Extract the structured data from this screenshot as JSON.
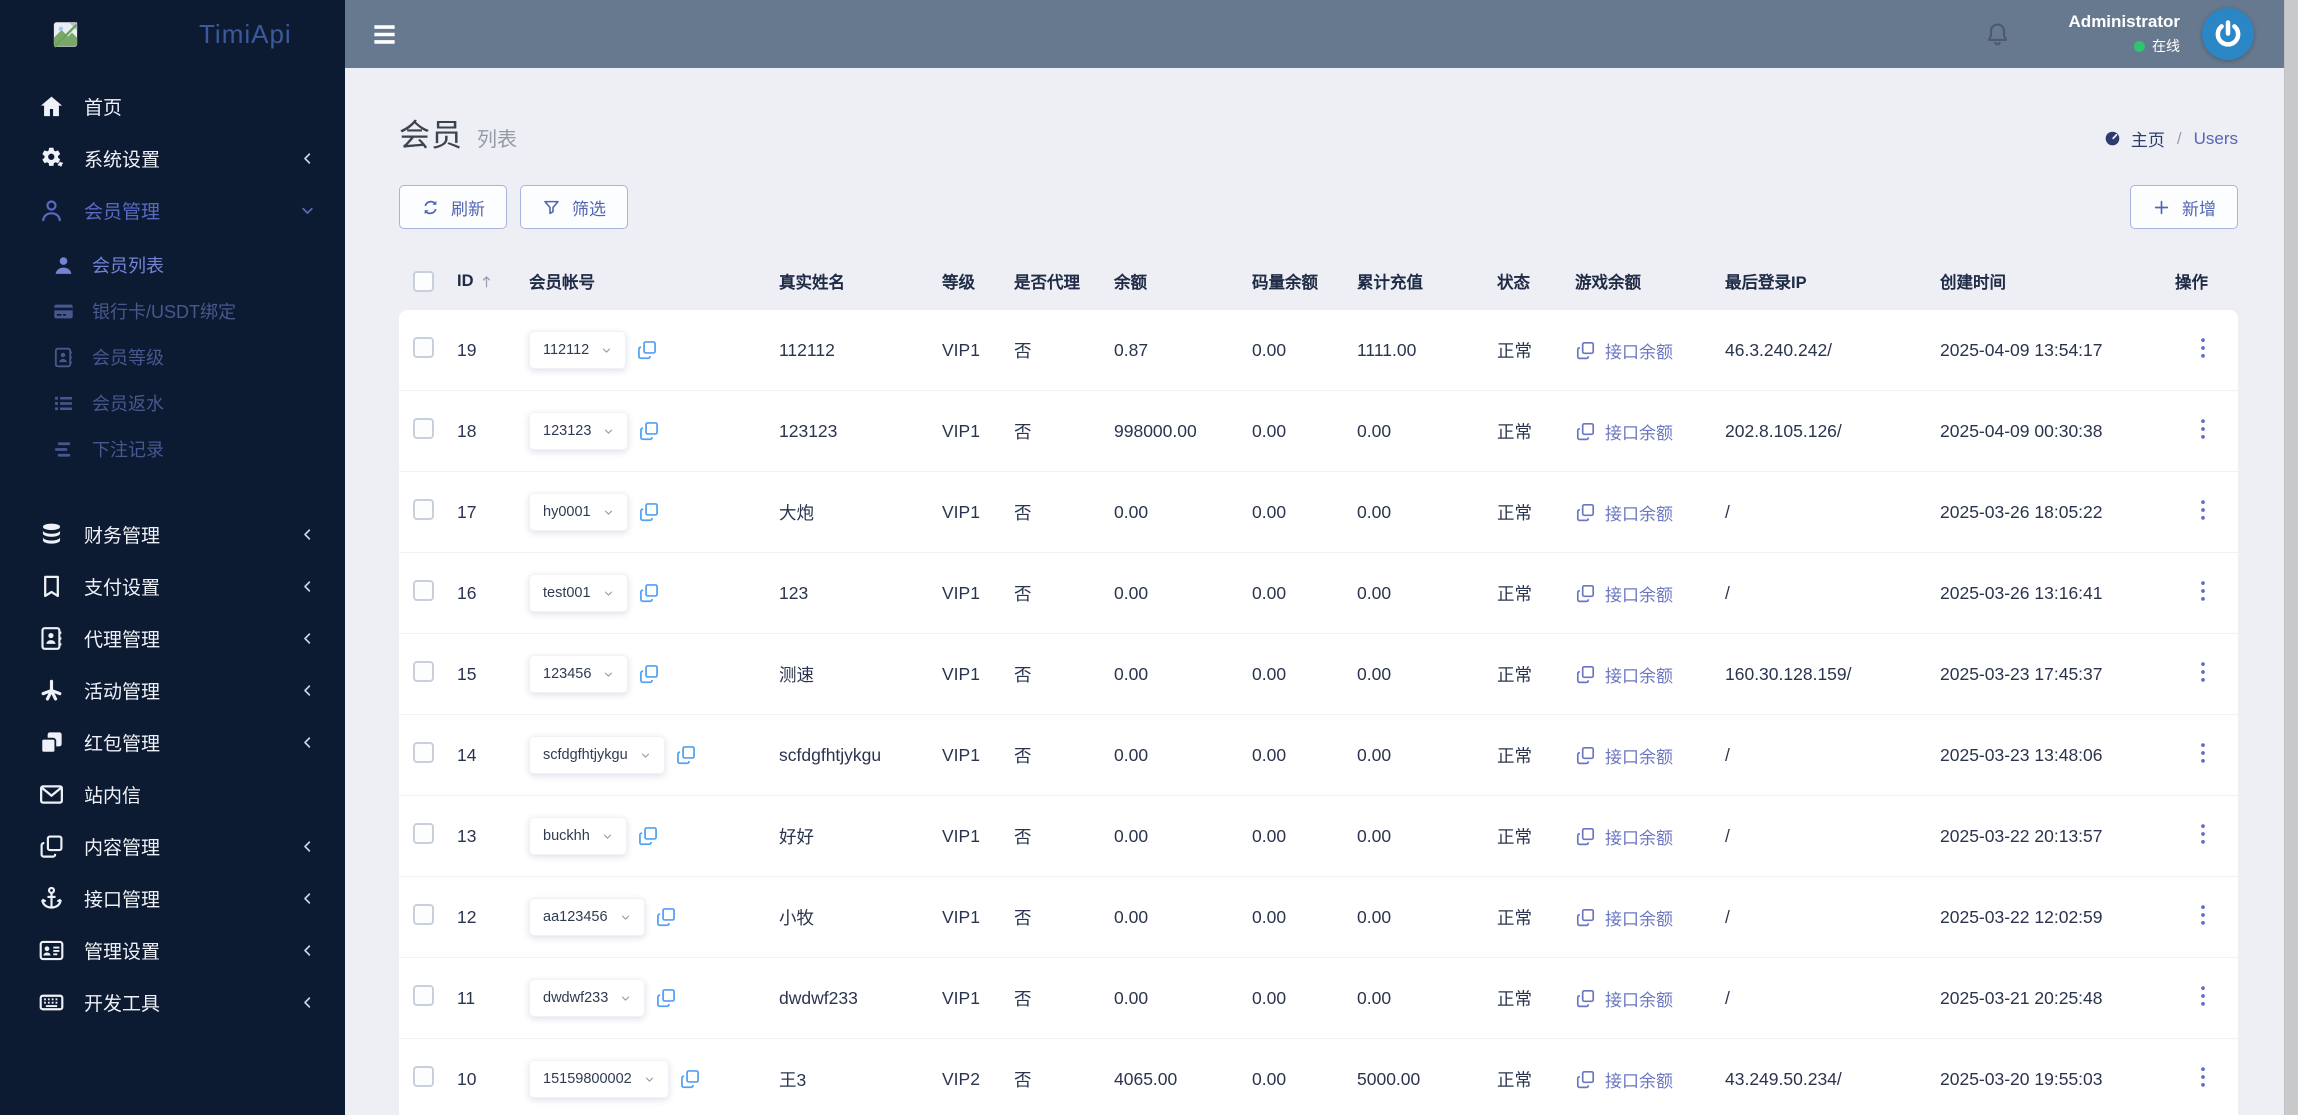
{
  "brand": {
    "name": "TimiApi"
  },
  "topbar": {
    "user_name": "Administrator",
    "user_status": "在线"
  },
  "breadcrumb": {
    "home": "主页",
    "separator": "/",
    "current": "Users"
  },
  "page": {
    "title": "会员",
    "subtitle": "列表"
  },
  "toolbar": {
    "refresh": "刷新",
    "filter": "筛选",
    "add": "新增"
  },
  "sidebar": {
    "items": [
      {
        "label": "首页",
        "icon": "home",
        "chevron": "",
        "active": false,
        "children": []
      },
      {
        "label": "系统设置",
        "icon": "gears",
        "chevron": "left",
        "active": false,
        "children": []
      },
      {
        "label": "会员管理",
        "icon": "user-o",
        "chevron": "down",
        "active": true,
        "children": [
          {
            "label": "会员列表",
            "icon": "user-solid",
            "active": true
          },
          {
            "label": "银行卡/USDT绑定",
            "icon": "credit-card",
            "active": false
          },
          {
            "label": "会员等级",
            "icon": "address-book",
            "active": false
          },
          {
            "label": "会员返水",
            "icon": "list",
            "active": false
          },
          {
            "label": "下注记录",
            "icon": "stream",
            "active": false
          }
        ]
      },
      {
        "label": "财务管理",
        "icon": "database",
        "chevron": "left",
        "active": false,
        "children": []
      },
      {
        "label": "支付设置",
        "icon": "bookmark",
        "chevron": "left",
        "active": false,
        "children": []
      },
      {
        "label": "代理管理",
        "icon": "address-book",
        "chevron": "left",
        "active": false,
        "children": []
      },
      {
        "label": "活动管理",
        "icon": "burst",
        "chevron": "left",
        "active": false,
        "children": []
      },
      {
        "label": "红包管理",
        "icon": "clone-solid",
        "chevron": "left",
        "active": false,
        "children": []
      },
      {
        "label": "站内信",
        "icon": "envelope",
        "chevron": "",
        "active": false,
        "children": []
      },
      {
        "label": "内容管理",
        "icon": "copy",
        "chevron": "left",
        "active": false,
        "children": []
      },
      {
        "label": "接口管理",
        "icon": "anchor",
        "chevron": "left",
        "active": false,
        "children": []
      },
      {
        "label": "管理设置",
        "icon": "id-card",
        "chevron": "left",
        "active": false,
        "children": []
      },
      {
        "label": "开发工具",
        "icon": "keyboard",
        "chevron": "left",
        "active": false,
        "children": []
      }
    ]
  },
  "table": {
    "columns": [
      {
        "key": "select",
        "label": ""
      },
      {
        "key": "id",
        "label": "ID"
      },
      {
        "key": "account",
        "label": "会员帐号"
      },
      {
        "key": "real_name",
        "label": "真实姓名"
      },
      {
        "key": "level",
        "label": "等级"
      },
      {
        "key": "is_agent",
        "label": "是否代理"
      },
      {
        "key": "balance",
        "label": "余额"
      },
      {
        "key": "code_balance",
        "label": "码量余额"
      },
      {
        "key": "total_recharge",
        "label": "累计充值"
      },
      {
        "key": "status",
        "label": "状态"
      },
      {
        "key": "game_balance",
        "label": "游戏余额"
      },
      {
        "key": "last_ip",
        "label": "最后登录IP"
      },
      {
        "key": "created_at",
        "label": "创建时间"
      },
      {
        "key": "ops",
        "label": "操作"
      }
    ],
    "game_balance_link_label": "接口余额",
    "rows": [
      {
        "id": "19",
        "account": "112112",
        "real_name": "112112",
        "level": "VIP1",
        "is_agent": "否",
        "balance": "0.87",
        "code_balance": "0.00",
        "total_recharge": "1111.00",
        "status": "正常",
        "last_ip": "46.3.240.242/",
        "created_at": "2025-04-09 13:54:17"
      },
      {
        "id": "18",
        "account": "123123",
        "real_name": "123123",
        "level": "VIP1",
        "is_agent": "否",
        "balance": "998000.00",
        "code_balance": "0.00",
        "total_recharge": "0.00",
        "status": "正常",
        "last_ip": "202.8.105.126/",
        "created_at": "2025-04-09 00:30:38"
      },
      {
        "id": "17",
        "account": "hy0001",
        "real_name": "大炮",
        "level": "VIP1",
        "is_agent": "否",
        "balance": "0.00",
        "code_balance": "0.00",
        "total_recharge": "0.00",
        "status": "正常",
        "last_ip": "/",
        "created_at": "2025-03-26 18:05:22"
      },
      {
        "id": "16",
        "account": "test001",
        "real_name": "123",
        "level": "VIP1",
        "is_agent": "否",
        "balance": "0.00",
        "code_balance": "0.00",
        "total_recharge": "0.00",
        "status": "正常",
        "last_ip": "/",
        "created_at": "2025-03-26 13:16:41"
      },
      {
        "id": "15",
        "account": "123456",
        "real_name": "测速",
        "level": "VIP1",
        "is_agent": "否",
        "balance": "0.00",
        "code_balance": "0.00",
        "total_recharge": "0.00",
        "status": "正常",
        "last_ip": "160.30.128.159/",
        "created_at": "2025-03-23 17:45:37"
      },
      {
        "id": "14",
        "account": "scfdgfhtjykgu",
        "real_name": "scfdgfhtjykgu",
        "level": "VIP1",
        "is_agent": "否",
        "balance": "0.00",
        "code_balance": "0.00",
        "total_recharge": "0.00",
        "status": "正常",
        "last_ip": "/",
        "created_at": "2025-03-23 13:48:06"
      },
      {
        "id": "13",
        "account": "buckhh",
        "real_name": "好好",
        "level": "VIP1",
        "is_agent": "否",
        "balance": "0.00",
        "code_balance": "0.00",
        "total_recharge": "0.00",
        "status": "正常",
        "last_ip": "/",
        "created_at": "2025-03-22 20:13:57"
      },
      {
        "id": "12",
        "account": "aa123456",
        "real_name": "小牧",
        "level": "VIP1",
        "is_agent": "否",
        "balance": "0.00",
        "code_balance": "0.00",
        "total_recharge": "0.00",
        "status": "正常",
        "last_ip": "/",
        "created_at": "2025-03-22 12:02:59"
      },
      {
        "id": "11",
        "account": "dwdwf233",
        "real_name": "dwdwf233",
        "level": "VIP1",
        "is_agent": "否",
        "balance": "0.00",
        "code_balance": "0.00",
        "total_recharge": "0.00",
        "status": "正常",
        "last_ip": "/",
        "created_at": "2025-03-21 20:25:48"
      },
      {
        "id": "10",
        "account": "15159800002",
        "real_name": "王3",
        "level": "VIP2",
        "is_agent": "否",
        "balance": "4065.00",
        "code_balance": "0.00",
        "total_recharge": "5000.00",
        "status": "正常",
        "last_ip": "43.249.50.234/",
        "created_at": "2025-03-20 19:55:03"
      }
    ]
  },
  "colors": {
    "sidebar_bg": "#0d1b32",
    "topbar_bg": "#67798f",
    "accent_indigo": "#5a69c2",
    "link_indigo": "#6b76c2",
    "copy_blue": "#53a0f4",
    "online_green": "#2fc46f",
    "avatar_blue": "#2b86c5",
    "content_bg": "#edeff4"
  }
}
